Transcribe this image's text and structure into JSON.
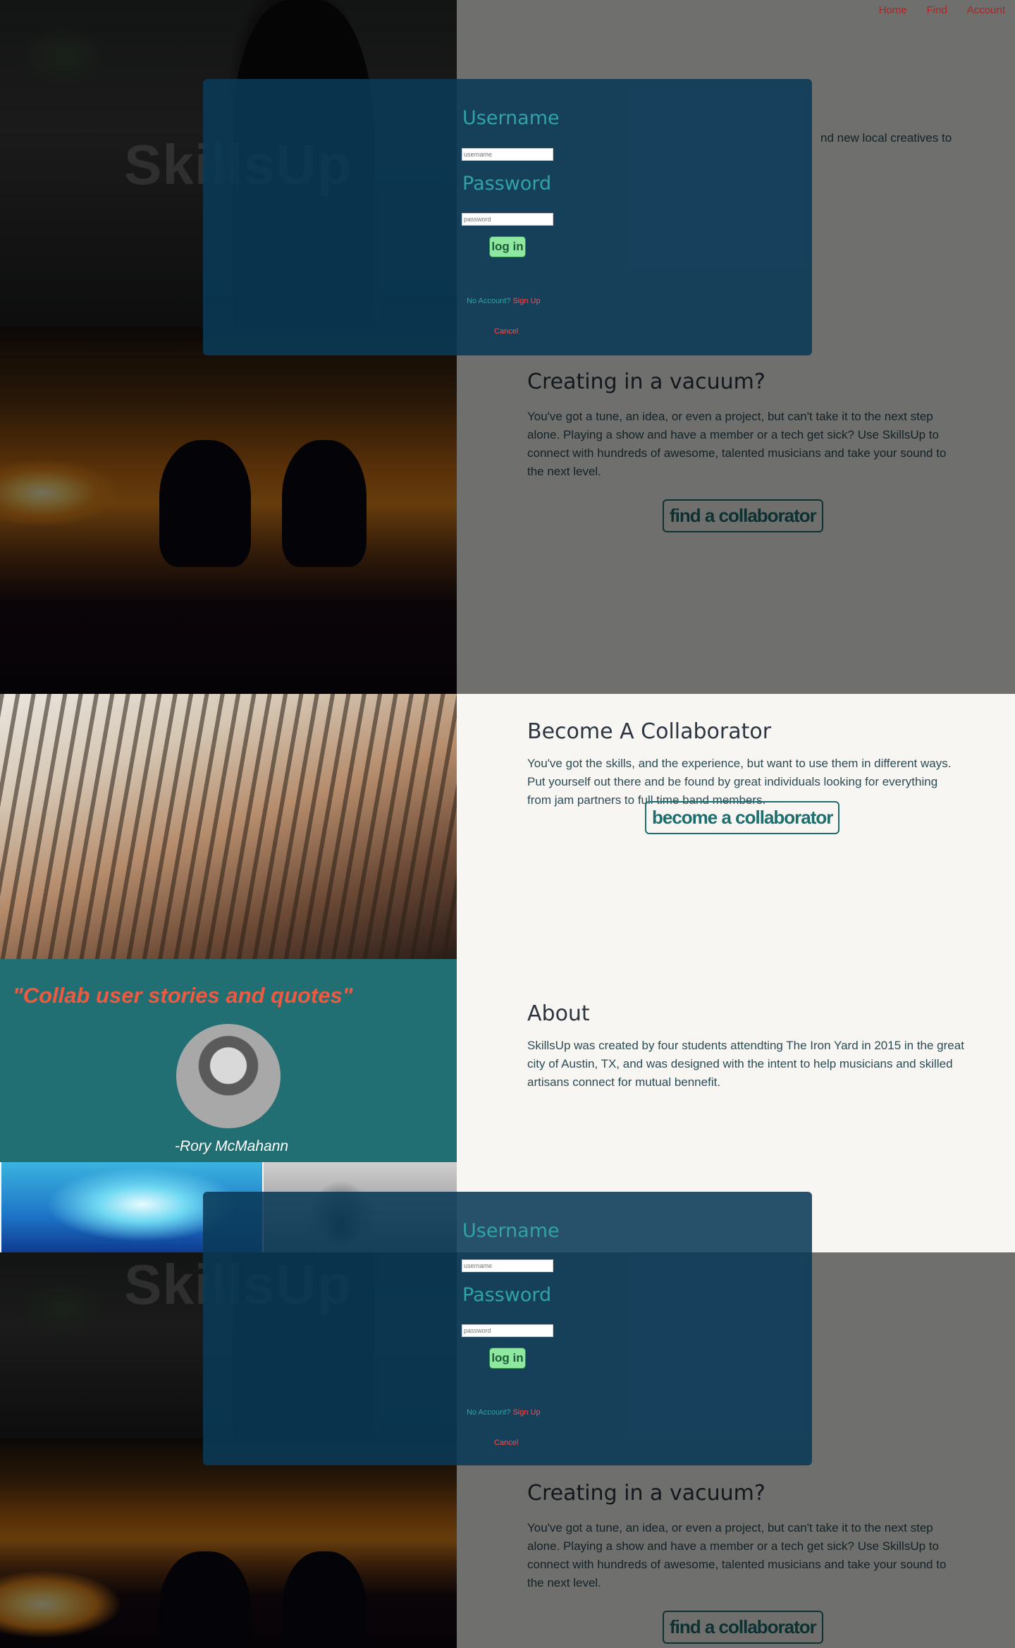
{
  "nav": {
    "home": "Home",
    "find": "Find",
    "account": "Account"
  },
  "brand": {
    "logo": "SkillsUp"
  },
  "hero_blurb_fragment": "nd new local creatives to",
  "modal": {
    "username_label": "Username",
    "username_placeholder": "username",
    "password_label": "Password",
    "password_placeholder": "password",
    "login_label": "log in",
    "no_account": "No Account?",
    "signup_label": "Sign Up",
    "cancel_label": "Cancel"
  },
  "vacuum": {
    "heading": "Creating in a vacuum?",
    "body": "You've got a tune, an idea, or even a project, but can't take it to the next step alone. Playing a show and have a member or a tech get sick? Use SkillsUp to connect with hundreds of awesome, talented musicians and take your sound to the next level.",
    "cta": "find a collaborator"
  },
  "become": {
    "heading": "Become A Collaborator",
    "body": "You've got the skills, and the experience, but want to use them in different ways. Put yourself out there and be found by great individuals looking for everything from jam partners to full time band members.",
    "cta": "become a collaborator"
  },
  "quotes": {
    "title": "\"Collab user stories and quotes\"",
    "author": "-Rory McMahann"
  },
  "about": {
    "heading": "About",
    "body": "SkillsUp was created by four students attendting The Iron Yard in 2015 in the great city of Austin, TX, and was designed with the intent to help musicians and skilled artisans connect for mutual bennefit."
  },
  "colors": {
    "nav_link": "#b22323",
    "teal": "#216f73",
    "quote_title": "#ee5a40",
    "modal_bg": "#0a3a58",
    "login_button": "#8ee8a0"
  }
}
